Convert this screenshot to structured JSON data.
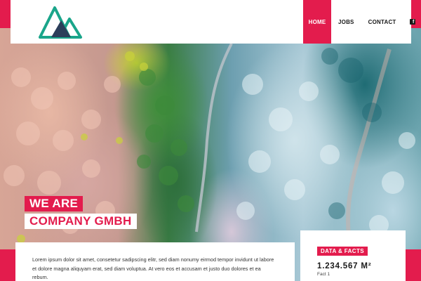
{
  "colors": {
    "accent": "#e31c4d",
    "logo_green": "#1aa58a",
    "logo_navy": "#2c3e5a"
  },
  "header": {
    "logo_icon": "mountain-logo-icon",
    "nav": [
      {
        "label": "HOME",
        "active": true
      },
      {
        "label": "JOBS",
        "active": false
      },
      {
        "label": "CONTACT",
        "active": false
      }
    ],
    "social_icon": "facebook-icon"
  },
  "hero": {
    "headline_line1": "WE ARE",
    "headline_line2": "COMPANY GMBH"
  },
  "intro": {
    "text": "Lorem ipsum dolor sit amet, consetetur sadipscing elitr, sed diam nonumy eirmod tempor invidunt ut labore et dolore magna aliquyam erat, sed diam voluptua. At vero eos et accusam et justo duo dolores et ea rebum."
  },
  "facts": {
    "badge": "DATA & FACTS",
    "value": "1.234.567 M²",
    "label": "Fact 1"
  }
}
